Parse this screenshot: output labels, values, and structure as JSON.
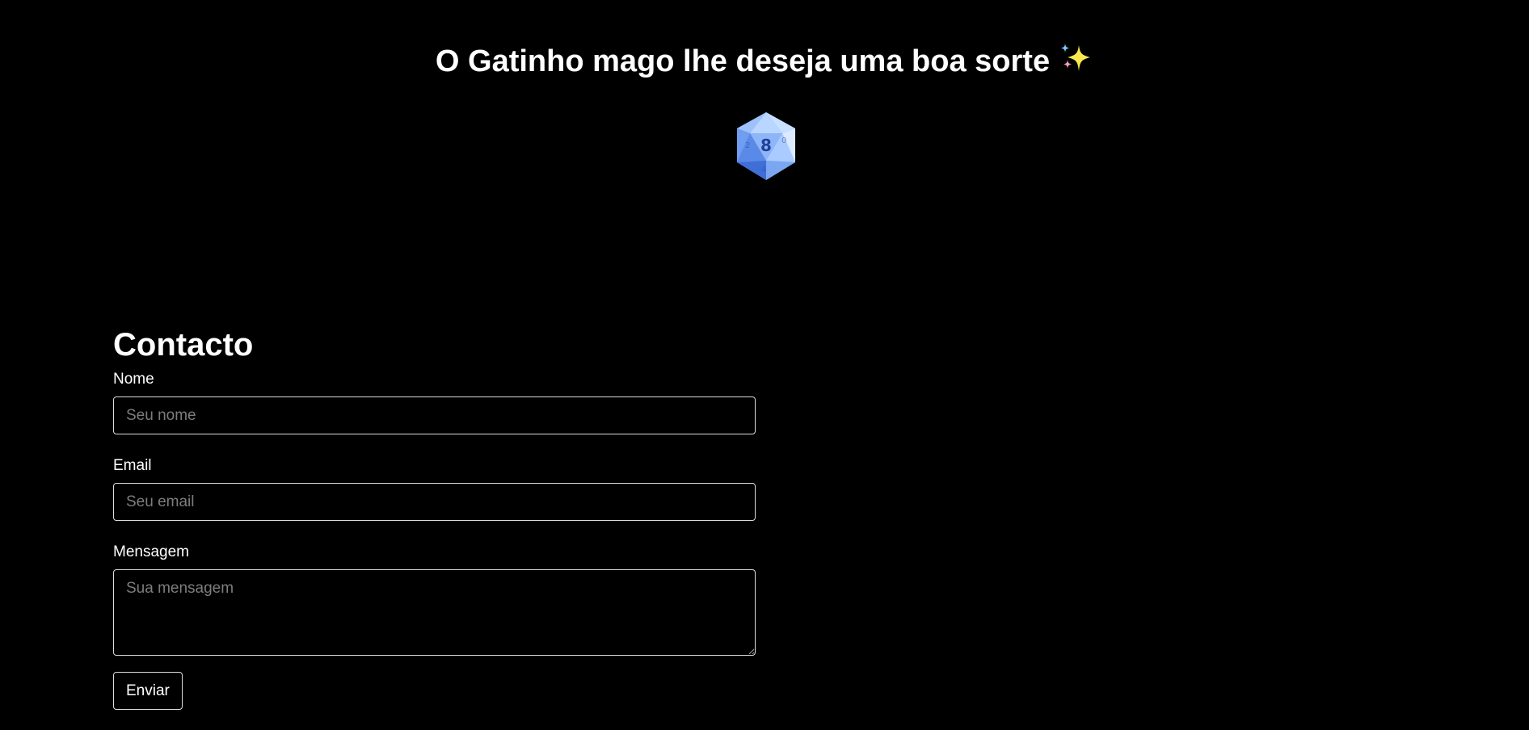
{
  "header": {
    "title": "O Gatinho mago lhe deseja uma boa sorte",
    "sparkle_icon": "sparkles-emoji",
    "sparkle_colors": [
      "#fce94f",
      "#7ec8ff",
      "#f49ac1"
    ]
  },
  "dice": {
    "icon": "d20-dice-icon",
    "face_value": "8",
    "colors": {
      "light": "#b8d6ff",
      "mid": "#6f9df0",
      "dark": "#3f6fd6",
      "numeral": "#1e3f9a"
    }
  },
  "contact": {
    "title": "Contacto",
    "name_label": "Nome",
    "name_placeholder": "Seu nome",
    "email_label": "Email",
    "email_placeholder": "Seu email",
    "message_label": "Mensagem",
    "message_placeholder": "Sua mensagem",
    "submit_label": "Enviar"
  }
}
